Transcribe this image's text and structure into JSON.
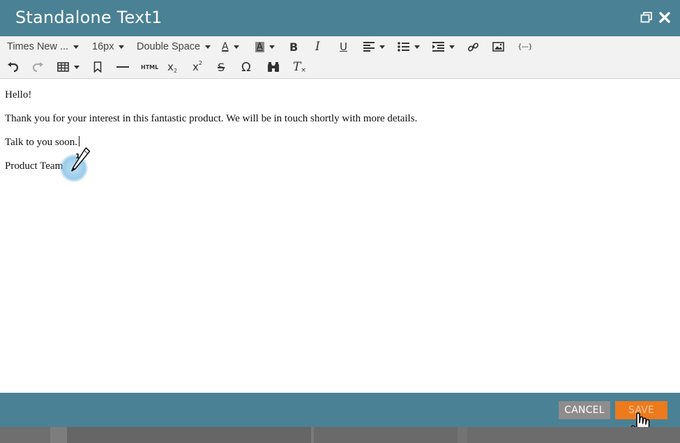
{
  "window": {
    "title": "Standalone Text1",
    "restore_icon": "restore-window-icon",
    "close_icon": "close-icon"
  },
  "toolbar": {
    "font_family": "Times New ...",
    "font_size": "16px",
    "line_spacing": "Double Space",
    "text_color_glyph": "A",
    "bg_color_glyph": "A",
    "bold_glyph": "B",
    "italic_glyph": "I",
    "underline_glyph": "U",
    "variable_glyph": "{---}",
    "html_glyph": "HTML",
    "subscript_glyph": "x",
    "superscript_glyph": "x",
    "strikethrough_glyph": "S",
    "special_char_glyph": "Ω",
    "clear_format_glyph": "T"
  },
  "editor": {
    "lines": [
      "Hello!",
      "Thank you for your interest in this fantastic product. We will be in touch shortly with more details.",
      "Talk to you soon.",
      "Product Team"
    ]
  },
  "footer": {
    "cancel_label": "CANCEL",
    "save_label": "SAVE"
  },
  "steps": {
    "step1": "1",
    "step2": "2"
  },
  "colors": {
    "header_bg": "#4a8195",
    "save_bg": "#ed7a1d",
    "cancel_bg": "#8d8d8d"
  }
}
